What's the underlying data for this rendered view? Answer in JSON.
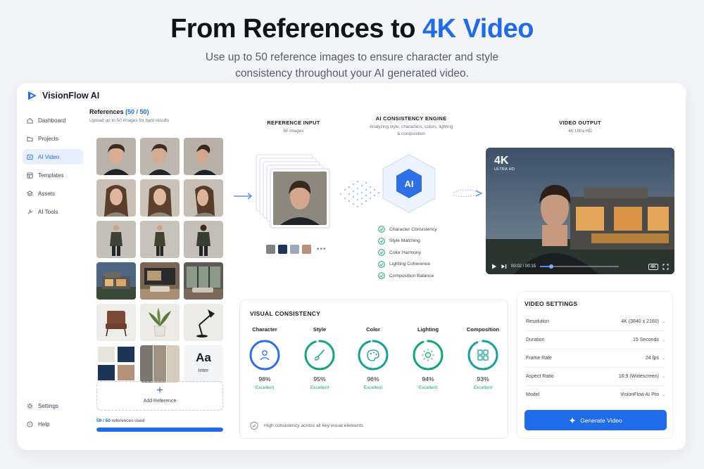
{
  "hero": {
    "title_main": "From References to ",
    "title_accent": "4K Video",
    "subtitle": "Use up to 50 reference images to ensure character and style consistency throughout your AI generated video."
  },
  "app": {
    "brand": "VisionFlow AI",
    "nav": [
      {
        "label": "Dashboard",
        "icon": "home-icon"
      },
      {
        "label": "Projects",
        "icon": "folder-icon"
      },
      {
        "label": "AI Video",
        "icon": "video-icon",
        "active": true
      },
      {
        "label": "Templates",
        "icon": "templates-icon"
      },
      {
        "label": "Assets",
        "icon": "assets-icon"
      },
      {
        "label": "AI Tools",
        "icon": "tools-icon"
      }
    ],
    "nav_bottom": [
      {
        "label": "Settings",
        "icon": "gear-icon"
      },
      {
        "label": "Help",
        "icon": "help-icon"
      }
    ]
  },
  "references": {
    "title": "References",
    "count": "(50 / 50)",
    "subtitle": "Upload up to 50 images for best results",
    "font_sample": "Aa",
    "font_name": "Inter",
    "add_label": "Add Reference",
    "used_count": "50 / 50",
    "used_text": "references used",
    "progress": 1.0
  },
  "pipeline": {
    "input_title": "REFERENCE INPUT",
    "input_sub": "50 images",
    "engine_title": "AI CONSISTENCY ENGINE",
    "engine_sub": "Analyzing style, characters, colors, lighting & composition",
    "engine_badge": "AI",
    "output_title": "VIDEO OUTPUT",
    "output_sub": "4K Ultra HD",
    "checks": [
      "Character Consistency",
      "Style Matching",
      "Color Harmony",
      "Lighting Coherence",
      "Composition Balance"
    ],
    "swatches": [
      "#7f8286",
      "#1d3558",
      "#9aa8bb",
      "#b8917a"
    ]
  },
  "video": {
    "badge": "4K",
    "badge_sub": "ULTRA HD",
    "time": "00:02 / 00:15",
    "progress": 0.14,
    "quality": "4K"
  },
  "consistency": {
    "title": "VISUAL CONSISTENCY",
    "metrics": [
      {
        "name": "Character",
        "value": 0.98,
        "pct": "98%",
        "status": "Excellent",
        "color": "#2f6fe6",
        "icon": "person-icon"
      },
      {
        "name": "Style",
        "value": 0.95,
        "pct": "95%",
        "status": "Excellent",
        "color": "#16a672",
        "icon": "brush-icon"
      },
      {
        "name": "Color",
        "value": 0.96,
        "pct": "96%",
        "status": "Excellent",
        "color": "#16a09a",
        "icon": "palette-icon"
      },
      {
        "name": "Lighting",
        "value": 0.94,
        "pct": "94%",
        "status": "Excellent",
        "color": "#16a672",
        "icon": "sun-icon"
      },
      {
        "name": "Composition",
        "value": 0.93,
        "pct": "93%",
        "status": "Excellent",
        "color": "#16a09a",
        "icon": "grid-icon"
      }
    ],
    "note": "High consistency across all key visual elements"
  },
  "settings": {
    "title": "VIDEO SETTINGS",
    "rows": [
      {
        "label": "Resolution",
        "value": "4K (3840 x 2160)"
      },
      {
        "label": "Duration",
        "value": "15 Seconds"
      },
      {
        "label": "Frame Rate",
        "value": "24 fps"
      },
      {
        "label": "Aspect Ratio",
        "value": "16:9 (Widescreen)"
      },
      {
        "label": "Model",
        "value": "VisionFlow AI Pro"
      }
    ],
    "button": "Generate Video"
  },
  "colors": {
    "accent": "#1f6be8",
    "success": "#16a672"
  }
}
